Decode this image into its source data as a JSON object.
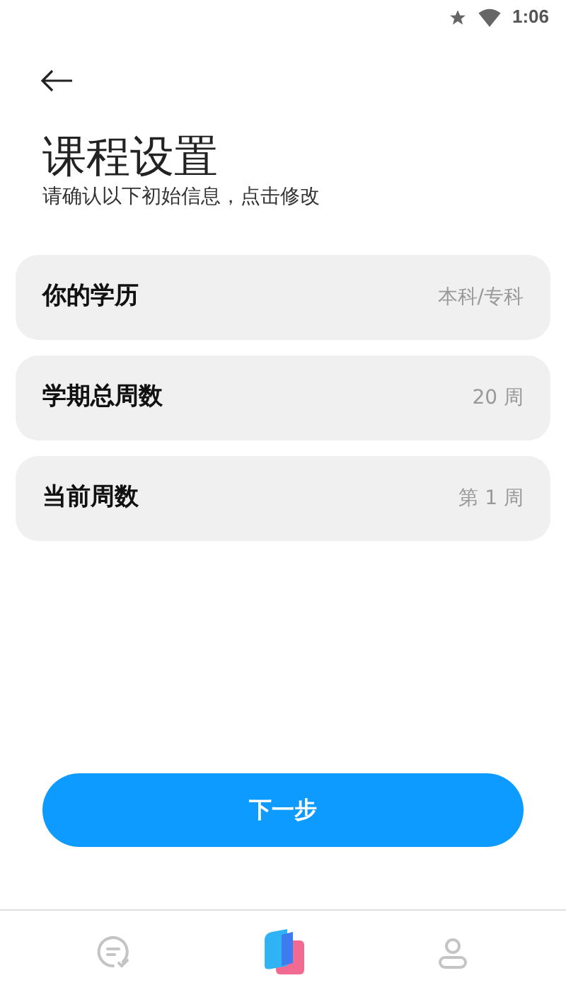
{
  "status_bar": {
    "time": "1:06"
  },
  "header": {
    "title": "课程设置",
    "subtitle": "请确认以下初始信息，点击修改"
  },
  "settings": [
    {
      "label": "你的学历",
      "value": "本科/专科"
    },
    {
      "label": "学期总周数",
      "value": "20 周"
    },
    {
      "label": "当前周数",
      "value": "第 1 周"
    }
  ],
  "next_button": "下一步",
  "bottom_nav": [
    {
      "kind": "chat",
      "selected": false
    },
    {
      "kind": "book",
      "selected": true
    },
    {
      "kind": "profile",
      "selected": false
    }
  ]
}
